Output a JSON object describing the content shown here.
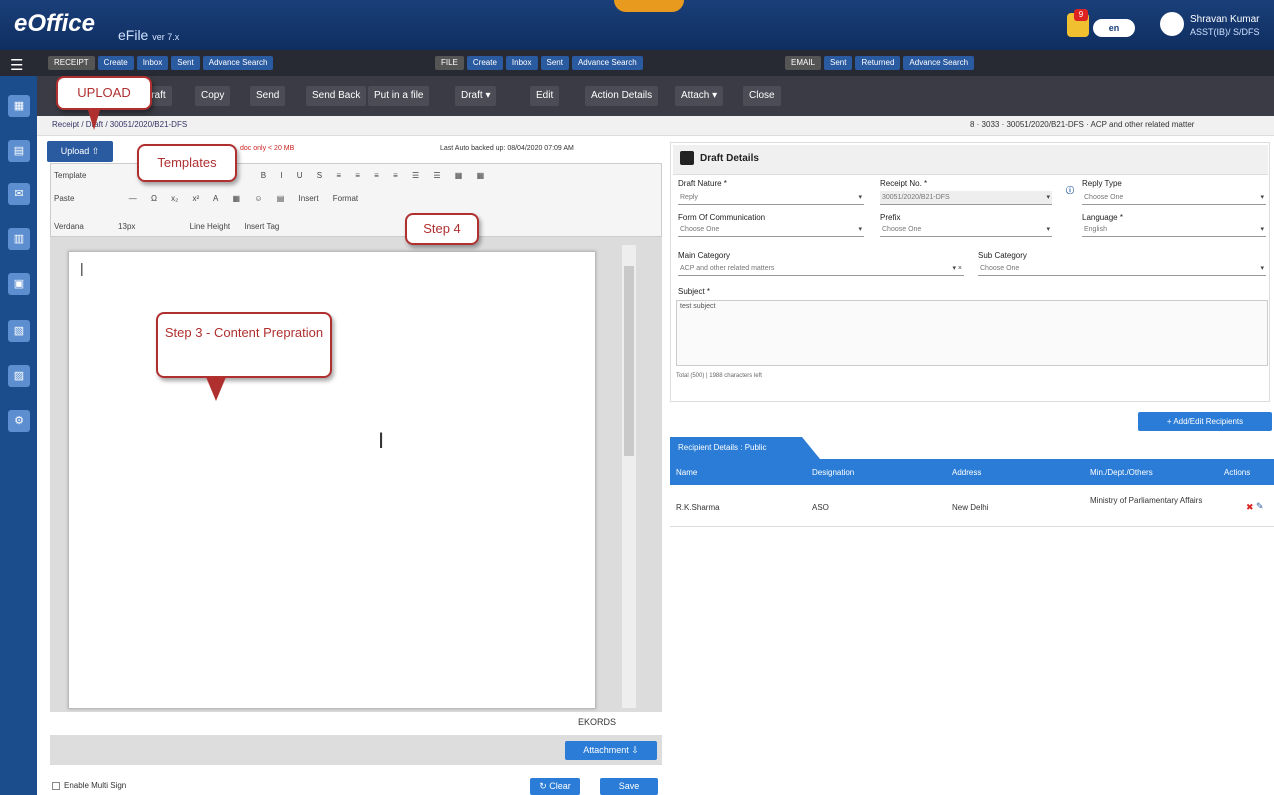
{
  "header": {
    "logo": "eOffice",
    "app": "eFile",
    "version": "ver 7.x",
    "toggle": "en",
    "notifications": "9",
    "user_name": "Shravan Kumar",
    "user_designation": "ASST(IB)/ S/DFS"
  },
  "menu": {
    "receipt": [
      "RECEIPT",
      "Create",
      "Inbox",
      "Sent",
      "Advance Search"
    ],
    "file": [
      "FILE",
      "Create",
      "Inbox",
      "Sent",
      "Advance Search"
    ],
    "email": [
      "EMAIL",
      "Sent",
      "Returned",
      "Advance Search"
    ]
  },
  "toolbar": {
    "buttons": [
      "Draft",
      "Copy",
      "Send",
      "Send Back",
      "Put in a file",
      "Draft ▾",
      "Edit",
      "Action Details",
      "Attach ▾",
      "Close"
    ]
  },
  "breadcrumb": "Receipt / Draft / 30051/2020/B21-DFS",
  "file_ref": "8 · 3033 · 30051/2020/B21-DFS · ACP and other related matter",
  "editor": {
    "upload": "Upload ⇧",
    "size_note": "doc only < 20 MB",
    "autosave": "Last Auto backed up: 08/04/2020 07:09 AM",
    "row1": [
      "Template",
      "B",
      "I",
      "U",
      "S",
      "≡",
      "≡",
      "≡",
      "≡",
      "☰",
      "☰",
      "▦",
      "▦"
    ],
    "row2": [
      "Paste",
      "—",
      "Ω",
      "x₂",
      "x²",
      "A",
      "▦",
      "☺",
      "▤",
      "Insert",
      "Format"
    ],
    "row3": [
      "Verdana",
      "13px",
      "Line Height",
      "Insert Tag"
    ],
    "cursor": "|",
    "ckeditor": "EKORDS",
    "attachment": "Attachment ⇩",
    "esign": "Enable Multi Sign",
    "clear": "↻ Clear",
    "save": "Save"
  },
  "callouts": {
    "upload": "UPLOAD",
    "templates": "Templates",
    "step4": "Step 4",
    "step3": "Step 3 - Content Prepration"
  },
  "draft": {
    "title": "Draft Details",
    "draft_nature_label": "Draft Nature *",
    "draft_nature": "Reply",
    "receipt_no_label": "Receipt No. *",
    "receipt_no": "30051/2020/B21-DFS",
    "reply_type_label": "Reply Type",
    "reply_type": "Choose One",
    "form_label": "Form Of Communication",
    "form": "Choose One",
    "prefix_label": "Prefix",
    "prefix": "Choose One",
    "language_label": "Language *",
    "language": "English",
    "main_cat_label": "Main Category",
    "main_cat": "ACP and other related matters",
    "sub_cat_label": "Sub Category",
    "sub_cat": "Choose One",
    "subject_label": "Subject *",
    "subject": "test subject",
    "char_count": "Total (500) | 1988 characters left"
  },
  "recipients": {
    "add": "+ Add/Edit Recipients",
    "tab": "Recipient Details : Public",
    "columns": [
      "Name",
      "Designation",
      "Address",
      "Min./Dept./Others",
      "Actions"
    ],
    "rows": [
      {
        "name": "R.K.Sharma",
        "designation": "ASO",
        "address": "New Delhi",
        "ministry": "Ministry of Parliamentary Affairs"
      }
    ]
  }
}
